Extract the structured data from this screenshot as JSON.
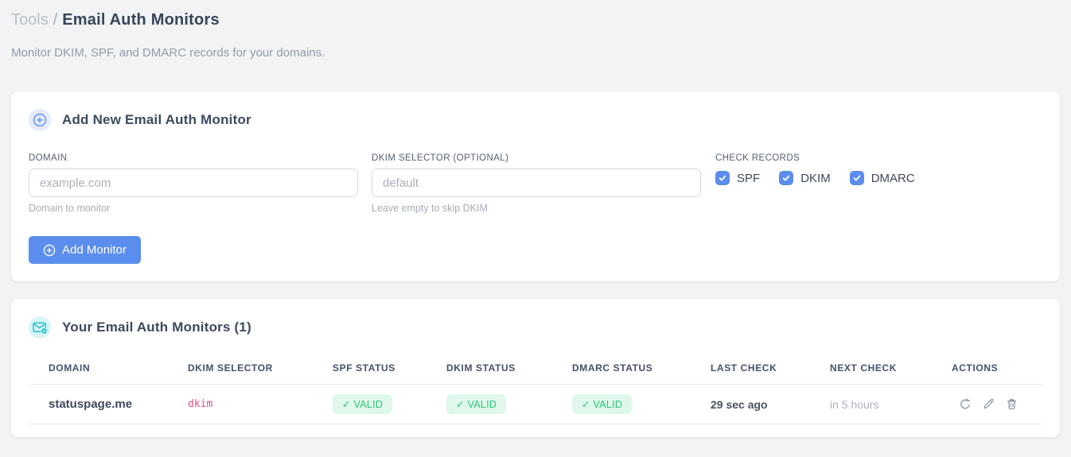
{
  "breadcrumb": {
    "section": "Tools",
    "separator": "/",
    "page": "Email Auth Monitors"
  },
  "subtitle": "Monitor DKIM, SPF, and DMARC records for your domains.",
  "add_form": {
    "title": "Add New Email Auth Monitor",
    "domain": {
      "label": "DOMAIN",
      "placeholder": "example.com",
      "value": "",
      "helper": "Domain to monitor"
    },
    "dkim_selector": {
      "label": "DKIM SELECTOR (OPTIONAL)",
      "placeholder": "default",
      "value": "",
      "helper": "Leave empty to skip DKIM"
    },
    "check_records": {
      "label": "CHECK RECORDS",
      "options": [
        {
          "label": "SPF",
          "checked": true
        },
        {
          "label": "DKIM",
          "checked": true
        },
        {
          "label": "DMARC",
          "checked": true
        }
      ]
    },
    "submit_label": "Add Monitor"
  },
  "monitors": {
    "title": "Your Email Auth Monitors (1)",
    "count": 1,
    "columns": [
      "DOMAIN",
      "DKIM SELECTOR",
      "SPF STATUS",
      "DKIM STATUS",
      "DMARC STATUS",
      "LAST CHECK",
      "NEXT CHECK",
      "ACTIONS"
    ],
    "rows": [
      {
        "domain": "statuspage.me",
        "dkim_selector": "dkim",
        "spf_status": "✓ VALID",
        "dkim_status": "✓ VALID",
        "dmarc_status": "✓ VALID",
        "last_check": "29 sec ago",
        "next_check": "in 5 hours"
      }
    ],
    "action_icons": [
      "refresh",
      "edit",
      "delete"
    ]
  },
  "colors": {
    "accent_blue": "#5b8dee",
    "accent_blue_bg": "#e4ebfc",
    "teal": "#1fbfcb",
    "teal_bg": "#d7f4f6",
    "valid_text": "#27c873",
    "valid_bg": "#dff8eb",
    "selector_pink": "#ea4c82",
    "page_bg": "#f1f3f5",
    "card_bg": "#ffffff"
  }
}
